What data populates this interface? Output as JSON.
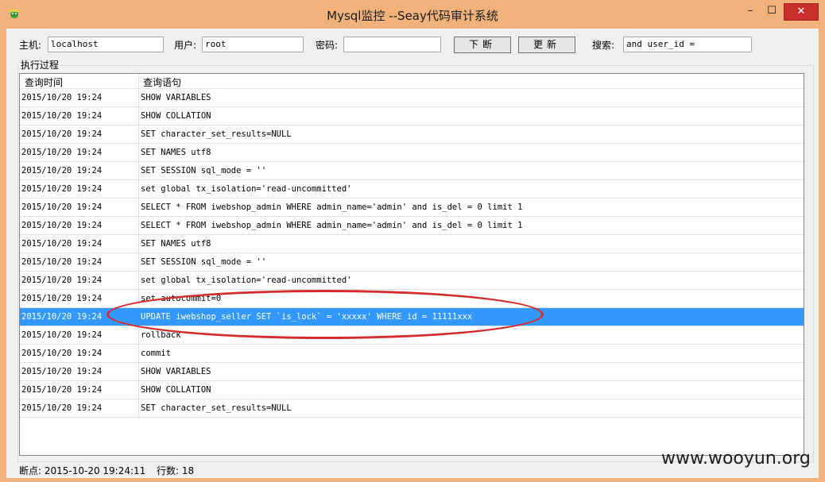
{
  "window": {
    "title": "Mysql监控 --Seay代码审计系统",
    "min_glyph": "–",
    "max_glyph": "☐",
    "close_glyph": "✕",
    "accent": "#f0b27a",
    "close_color": "#c9302c"
  },
  "toolbar": {
    "host_label": "主机:",
    "host_value": "localhost",
    "user_label": "用户:",
    "user_value": "root",
    "password_label": "密码:",
    "password_value": "",
    "break_button": "下断",
    "refresh_button": "更新",
    "search_label": "搜索:",
    "search_value": "and user_id ="
  },
  "group": {
    "label": "执行过程"
  },
  "table": {
    "columns": [
      "查询时间",
      "查询语句"
    ],
    "selected_color": "#3399ff",
    "rows": [
      {
        "time": "2015/10/20 19:24",
        "query": "SHOW VARIABLES"
      },
      {
        "time": "2015/10/20 19:24",
        "query": "SHOW COLLATION"
      },
      {
        "time": "2015/10/20 19:24",
        "query": "SET character_set_results=NULL"
      },
      {
        "time": "2015/10/20 19:24",
        "query": "SET NAMES utf8"
      },
      {
        "time": "2015/10/20 19:24",
        "query": "SET SESSION sql_mode = ''"
      },
      {
        "time": "2015/10/20 19:24",
        "query": "set global tx_isolation='read-uncommitted'"
      },
      {
        "time": "2015/10/20 19:24",
        "query": "SELECT * FROM iwebshop_admin WHERE admin_name='admin' and is_del = 0 limit 1"
      },
      {
        "time": "2015/10/20 19:24",
        "query": "SELECT * FROM iwebshop_admin WHERE admin_name='admin' and is_del = 0 limit 1"
      },
      {
        "time": "2015/10/20 19:24",
        "query": "SET NAMES utf8"
      },
      {
        "time": "2015/10/20 19:24",
        "query": "SET SESSION sql_mode = ''"
      },
      {
        "time": "2015/10/20 19:24",
        "query": "set global tx_isolation='read-uncommitted'"
      },
      {
        "time": "2015/10/20 19:24",
        "query": "set autocommit=0"
      },
      {
        "time": "2015/10/20 19:24",
        "query": "UPDATE iwebshop_seller SET `is_lock` = 'xxxxx' WHERE id = 11111xxx",
        "selected": true
      },
      {
        "time": "2015/10/20 19:24",
        "query": "rollback"
      },
      {
        "time": "2015/10/20 19:24",
        "query": "commit"
      },
      {
        "time": "2015/10/20 19:24",
        "query": "SHOW VARIABLES"
      },
      {
        "time": "2015/10/20 19:24",
        "query": "SHOW COLLATION"
      },
      {
        "time": "2015/10/20 19:24",
        "query": "SET character_set_results=NULL"
      }
    ]
  },
  "status": {
    "breakpoint": "断点: 2015-10-20 19:24:11",
    "rows": "行数: 18"
  },
  "watermark": "www.wooyun.org"
}
